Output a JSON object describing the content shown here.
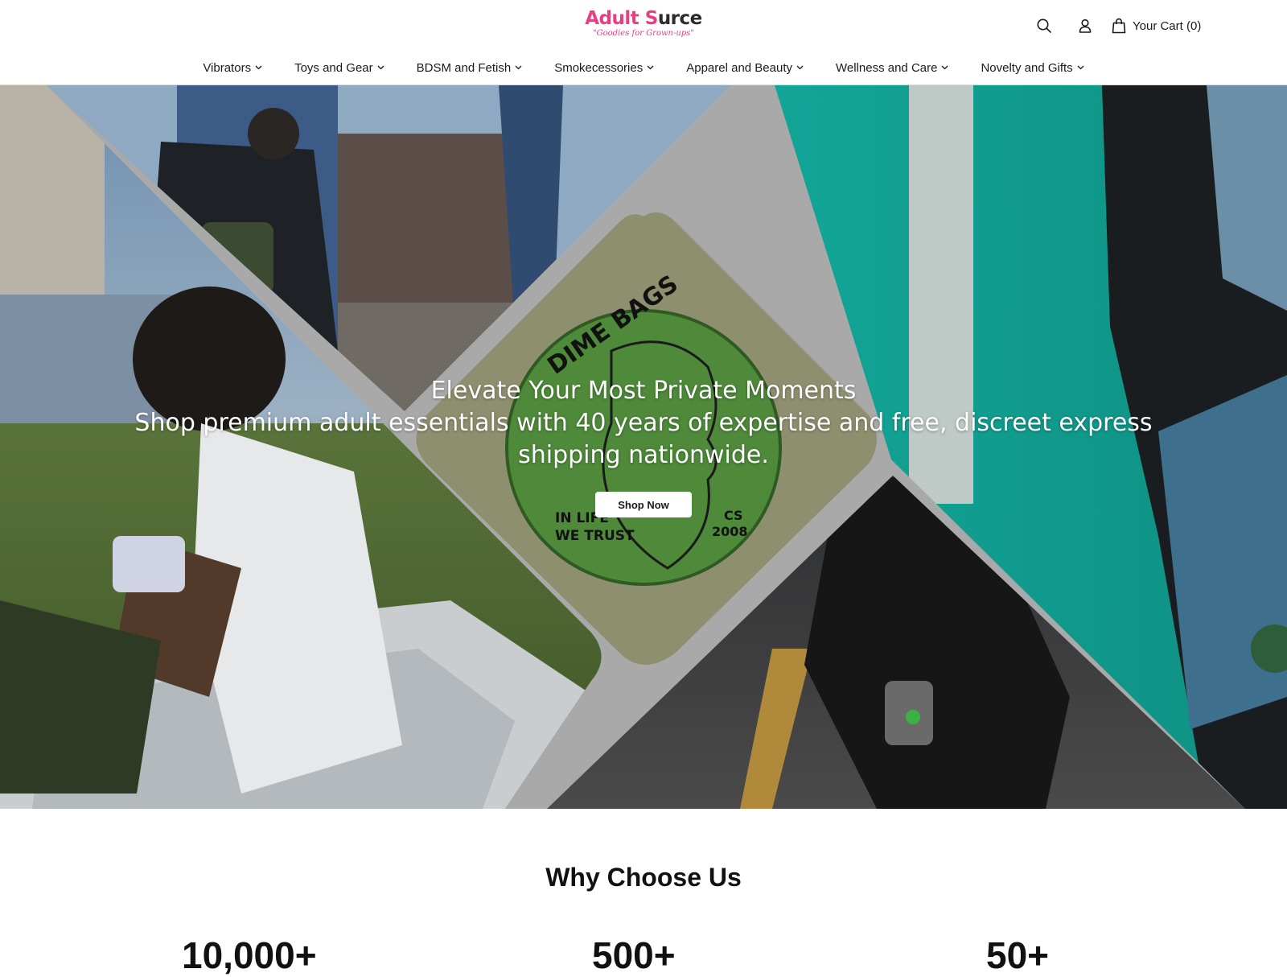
{
  "brand": {
    "name_part1": "Adult S",
    "name_part2": "urce",
    "tagline": "\"Goodies for Grown-ups\""
  },
  "header": {
    "search_icon": "search-icon",
    "account_icon": "user-icon",
    "cart_icon": "shopping-bag-icon",
    "cart_label": "Your Cart (0)"
  },
  "nav": {
    "items": [
      {
        "label": "Vibrators"
      },
      {
        "label": "Toys and Gear"
      },
      {
        "label": "BDSM and Fetish"
      },
      {
        "label": "Smokecessories"
      },
      {
        "label": "Apparel and Beauty"
      },
      {
        "label": "Wellness and Care"
      },
      {
        "label": "Novelty and Gifts"
      }
    ]
  },
  "hero": {
    "title": "Elevate Your Most Private Moments",
    "subtitle": "Shop premium adult essentials with 40 years of expertise and free, discreet express shipping nationwide.",
    "cta_label": "Shop Now",
    "logo_text_1": "DIME BAGS",
    "logo_text_2": "IN LIFE",
    "logo_text_3": "WE TRUST",
    "logo_text_4": "CS",
    "logo_text_5": "2008"
  },
  "why": {
    "title": "Why Choose Us",
    "stats": [
      {
        "value": "10,000+"
      },
      {
        "value": "500+"
      },
      {
        "value": "50+"
      }
    ]
  },
  "colors": {
    "brand_pink": "#e83e84",
    "teal": "#18a99a",
    "divider_gray": "#a9a9a9"
  }
}
